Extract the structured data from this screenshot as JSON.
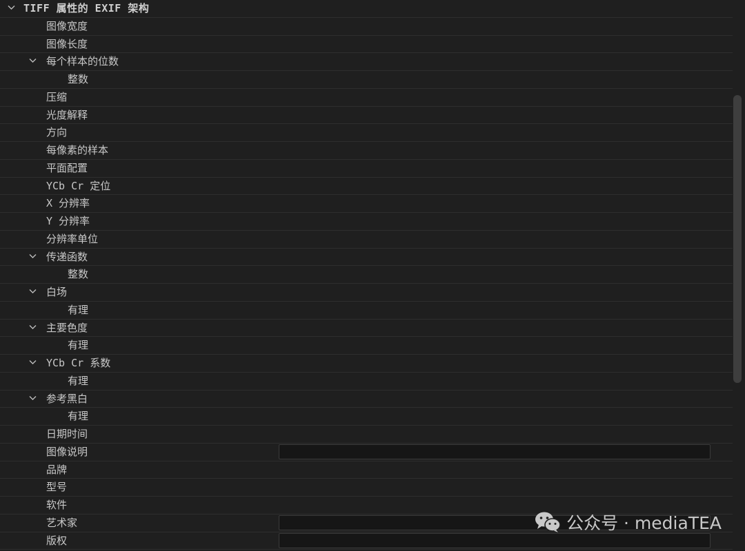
{
  "tree": {
    "rows": [
      {
        "label": "TIFF 属性的 EXIF 架构",
        "level": 0,
        "expanded": true,
        "section": true
      },
      {
        "label": "图像宽度",
        "level": 1
      },
      {
        "label": "图像长度",
        "level": 1
      },
      {
        "label": "每个样本的位数",
        "level": 1,
        "expanded": true
      },
      {
        "label": "整数",
        "level": 2
      },
      {
        "label": "压缩",
        "level": 1
      },
      {
        "label": "光度解释",
        "level": 1
      },
      {
        "label": "方向",
        "level": 1
      },
      {
        "label": "每像素的样本",
        "level": 1
      },
      {
        "label": "平面配置",
        "level": 1
      },
      {
        "label": "YCb Cr 定位",
        "level": 1
      },
      {
        "label": "X 分辨率",
        "level": 1
      },
      {
        "label": "Y 分辨率",
        "level": 1
      },
      {
        "label": "分辨率单位",
        "level": 1
      },
      {
        "label": "传递函数",
        "level": 1,
        "expanded": true
      },
      {
        "label": "整数",
        "level": 2
      },
      {
        "label": "白场",
        "level": 1,
        "expanded": true
      },
      {
        "label": "有理",
        "level": 2
      },
      {
        "label": "主要色度",
        "level": 1,
        "expanded": true
      },
      {
        "label": "有理",
        "level": 2
      },
      {
        "label": "YCb Cr 系数",
        "level": 1,
        "expanded": true
      },
      {
        "label": "有理",
        "level": 2
      },
      {
        "label": "参考黑白",
        "level": 1,
        "expanded": true
      },
      {
        "label": "有理",
        "level": 2
      },
      {
        "label": "日期时间",
        "level": 1
      },
      {
        "label": "图像说明",
        "level": 1,
        "field": ""
      },
      {
        "label": "品牌",
        "level": 1
      },
      {
        "label": "型号",
        "level": 1
      },
      {
        "label": "软件",
        "level": 1
      },
      {
        "label": "艺术家",
        "level": 1,
        "field": ""
      },
      {
        "label": "版权",
        "level": 1,
        "field": ""
      }
    ]
  },
  "watermark": {
    "text": "公众号 · mediaTEA",
    "icon": "wechat-icon"
  },
  "colors": {
    "background": "#1f1f1f",
    "text": "#c8c8c8",
    "row_divider": "#2e2e2e",
    "field_background": "#161616",
    "scroll_thumb": "#3e3e3e"
  }
}
